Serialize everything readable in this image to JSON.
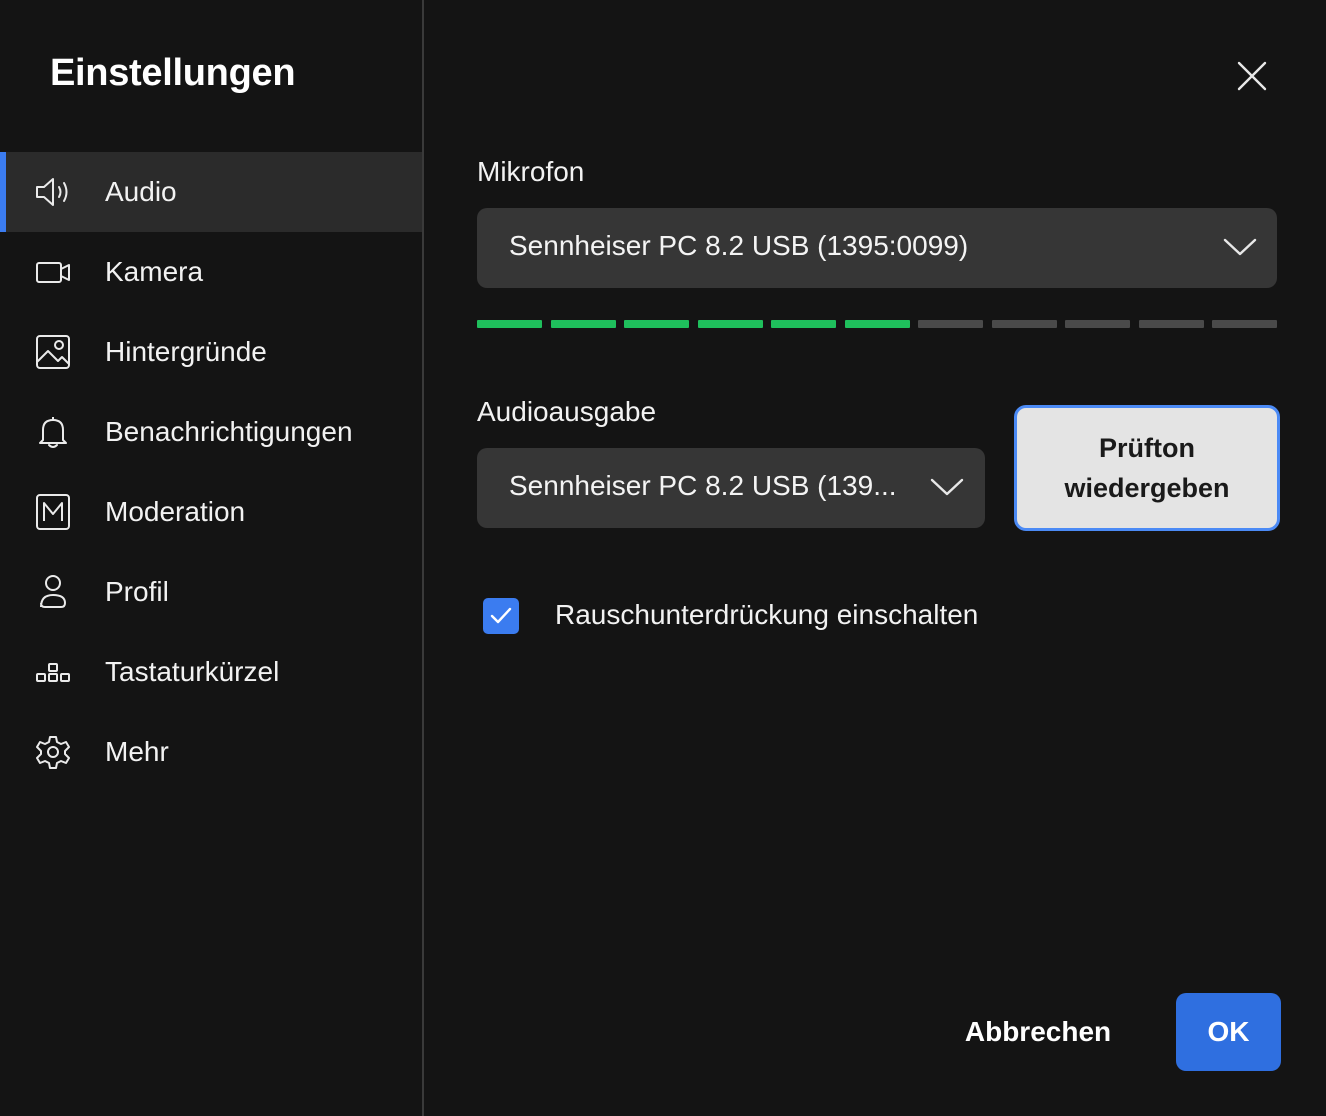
{
  "sidebar": {
    "title": "Einstellungen",
    "items": [
      {
        "label": "Audio",
        "icon": "speaker-icon",
        "active": true
      },
      {
        "label": "Kamera",
        "icon": "camera-icon",
        "active": false
      },
      {
        "label": "Hintergründe",
        "icon": "image-icon",
        "active": false
      },
      {
        "label": "Benachrichtigungen",
        "icon": "bell-icon",
        "active": false
      },
      {
        "label": "Moderation",
        "icon": "moderation-icon",
        "active": false
      },
      {
        "label": "Profil",
        "icon": "person-icon",
        "active": false
      },
      {
        "label": "Tastaturkürzel",
        "icon": "keyboard-shortcut-icon",
        "active": false
      },
      {
        "label": "Mehr",
        "icon": "gear-icon",
        "active": false
      }
    ]
  },
  "audio": {
    "microphone": {
      "label": "Mikrofon",
      "selected": "Sennheiser PC 8.2 USB (1395:0099)"
    },
    "level_meter": {
      "total_segments": 11,
      "active_segments": 6,
      "active_color": "#1fbf5c",
      "inactive_color": "#4a4a4a"
    },
    "output": {
      "label": "Audioausgabe",
      "selected": "Sennheiser PC 8.2 USB (139..."
    },
    "test_button": {
      "line1": "Prüfton",
      "line2": "wiedergeben"
    },
    "noise_suppression": {
      "label": "Rauschunterdrückung einschalten",
      "checked": true
    }
  },
  "footer": {
    "cancel_label": "Abbrechen",
    "ok_label": "OK"
  },
  "colors": {
    "accent": "#3b7cf0",
    "background": "#141414",
    "select_background": "#363636"
  }
}
